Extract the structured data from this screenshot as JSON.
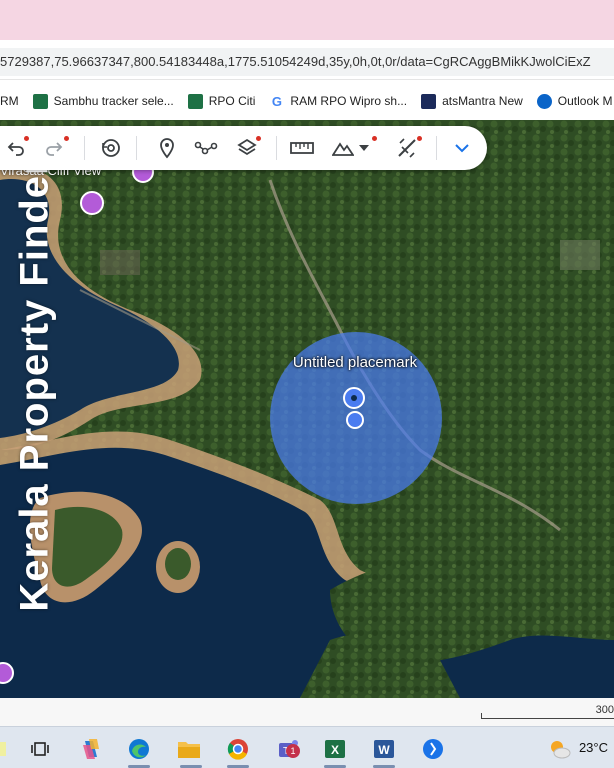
{
  "browser": {
    "url": "5729387,75.96637347,800.54183448a,1775.51054249d,35y,0h,0t,0r/data=CgRCAggBMikKJwolCiExZ",
    "bookmarks": [
      {
        "label": "RM",
        "icon": "none"
      },
      {
        "label": "Sambhu tracker sele...",
        "icon": "excel-icon"
      },
      {
        "label": "RPO Citi",
        "icon": "excel-icon"
      },
      {
        "label": "RAM RPO Wipro sh...",
        "icon": "google-icon"
      },
      {
        "label": "atsMantra New",
        "icon": "atsmantra-icon"
      },
      {
        "label": "Outlook M",
        "icon": "outlook-icon"
      }
    ]
  },
  "map": {
    "watermark": "Kerala Property Finder",
    "placemark_label": "Untitled placemark",
    "poi_label": "Virasaa Cliff View",
    "scale_text": "300"
  },
  "toolbar": {
    "tools": [
      "undo-icon",
      "redo-icon",
      "history-icon",
      "placemark-icon",
      "path-icon",
      "layers-icon",
      "ruler-icon",
      "terrain-icon",
      "measure-icon",
      "chevron-down-icon"
    ]
  },
  "taskbar": {
    "temperature": "23°C",
    "teams_badge": "1",
    "apps": [
      "search-icon",
      "task-view-icon",
      "copilot-icon",
      "edge-icon",
      "file-explorer-icon",
      "chrome-icon",
      "teams-icon",
      "excel-icon",
      "word-icon",
      "app-icon"
    ]
  },
  "colors": {
    "accent": "#1a73e8",
    "placemark_circle": "#4a7cf0",
    "water": "#0d2a4a",
    "land": "#2f4d24",
    "shore": "#c9a57a"
  }
}
